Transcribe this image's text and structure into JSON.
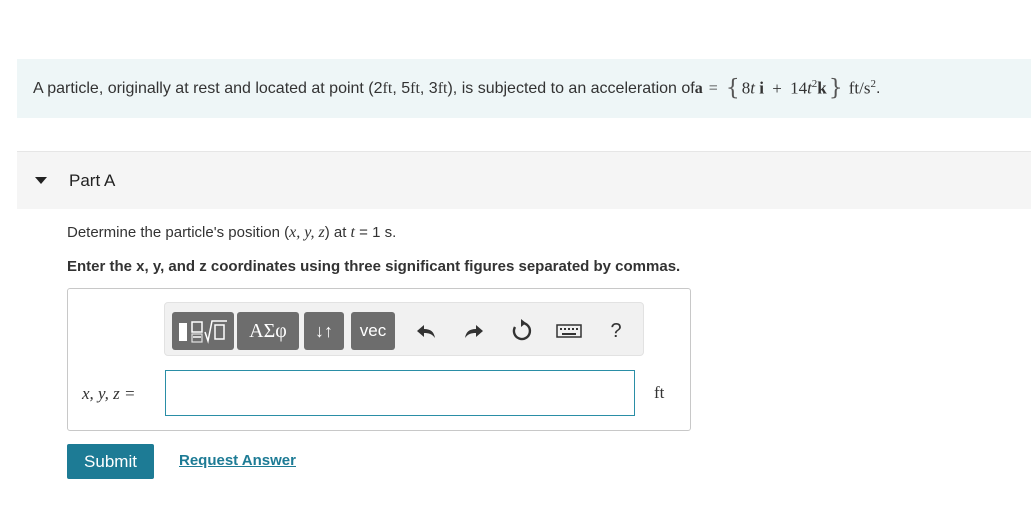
{
  "problem": {
    "intro": "A particle, originally at rest and located at point (2 ",
    "unit_ft": "ft",
    "sep": ", 5 ",
    "sep2": ", 3 ",
    "close": "), is subjected to an acceleration of ",
    "accel_var": "a",
    "equals": "=",
    "open_brace": "{",
    "term1_coef": "8",
    "term1_var": "t",
    "term1_unit": "i",
    "plus": "+",
    "term2_coef": "14",
    "term2_var": "t",
    "term2_exp": "2",
    "term2_unit": "k",
    "close_brace": "}",
    "accel_units": "ft/s",
    "accel_units_exp": "2",
    "end": "."
  },
  "part": {
    "title": "Part A"
  },
  "question": {
    "text_before": "Determine the particle's position (",
    "coords": "x, y, z",
    "text_mid": ") at ",
    "t_var": "t",
    "text_after": " = 1 s."
  },
  "instruction": "Enter the x, y, and z coordinates using three significant figures separated by commas.",
  "toolbar": {
    "greek_label": "ΑΣφ",
    "arrows_label": "↓↑",
    "vec_label": "vec",
    "help_label": "?"
  },
  "answer": {
    "label": "x, y, z =",
    "value": "",
    "unit": "ft"
  },
  "actions": {
    "submit_label": "Submit",
    "request_label": "Request Answer"
  },
  "colors": {
    "accent": "#1d7b95",
    "problem_bg": "#eef6f7",
    "toolbar_btn": "#6d6d6d"
  }
}
